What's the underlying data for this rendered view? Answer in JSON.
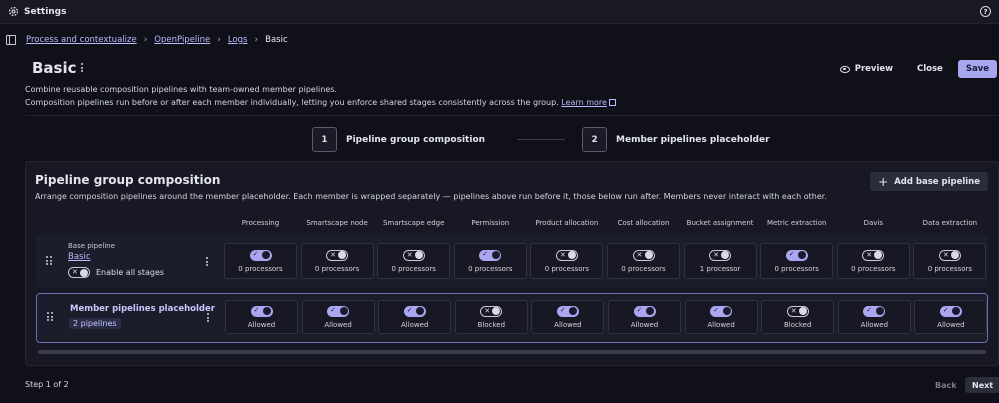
{
  "titlebar": {
    "title": "Settings",
    "icon": "gear-icon",
    "help_icon": "help-circle-icon"
  },
  "breadcrumb": {
    "items": [
      "Process and contextualize",
      "OpenPipeline",
      "Logs"
    ],
    "current": "Basic"
  },
  "page": {
    "title": "Basic",
    "description_line1": "Combine reusable composition pipelines with team-owned member pipelines.",
    "description_line2": "Composition pipelines run before or after each member individually, letting you enforce shared stages consistently across the group.",
    "learn_more": "Learn more"
  },
  "actions": {
    "preview": "Preview",
    "close": "Close",
    "save": "Save"
  },
  "stepper": {
    "steps": [
      {
        "num": "1",
        "label": "Pipeline group composition"
      },
      {
        "num": "2",
        "label": "Member pipelines placeholder"
      }
    ]
  },
  "composition": {
    "title": "Pipeline group composition",
    "subtitle": "Arrange composition pipelines around the member placeholder. Each member is wrapped separately — pipelines above run before it, those below run after. Members never interact with each other.",
    "add_button": "Add base pipeline",
    "columns": [
      "Processing",
      "Smartscape node",
      "Smartscape edge",
      "Permission",
      "Product allocation",
      "Cost allocation",
      "Bucket assignment",
      "Metric extraction",
      "Davis",
      "Data extraction"
    ],
    "base_row": {
      "small_label": "Base pipeline",
      "name": "Basic",
      "enable_label": "Enable all stages",
      "enable_on": false,
      "cells": [
        {
          "on": true,
          "text": "0 processors"
        },
        {
          "on": false,
          "text": "0 processors"
        },
        {
          "on": false,
          "text": "0 processors"
        },
        {
          "on": true,
          "text": "0 processors"
        },
        {
          "on": false,
          "text": "0 processors"
        },
        {
          "on": false,
          "text": "0 processors"
        },
        {
          "on": false,
          "text": "1 processor"
        },
        {
          "on": true,
          "text": "0 processors"
        },
        {
          "on": false,
          "text": "0 processors"
        },
        {
          "on": false,
          "text": "0 processors"
        }
      ]
    },
    "member_row": {
      "name": "Member pipelines placeholder",
      "badge": "2 pipelines",
      "cells": [
        {
          "on": true,
          "text": "Allowed"
        },
        {
          "on": true,
          "text": "Allowed"
        },
        {
          "on": true,
          "text": "Allowed"
        },
        {
          "on": false,
          "text": "Blocked"
        },
        {
          "on": true,
          "text": "Allowed"
        },
        {
          "on": true,
          "text": "Allowed"
        },
        {
          "on": true,
          "text": "Allowed"
        },
        {
          "on": false,
          "text": "Blocked"
        },
        {
          "on": true,
          "text": "Allowed"
        },
        {
          "on": true,
          "text": "Allowed"
        }
      ]
    }
  },
  "footer": {
    "step_text": "Step 1 of 2",
    "back": "Back",
    "next": "Next"
  }
}
